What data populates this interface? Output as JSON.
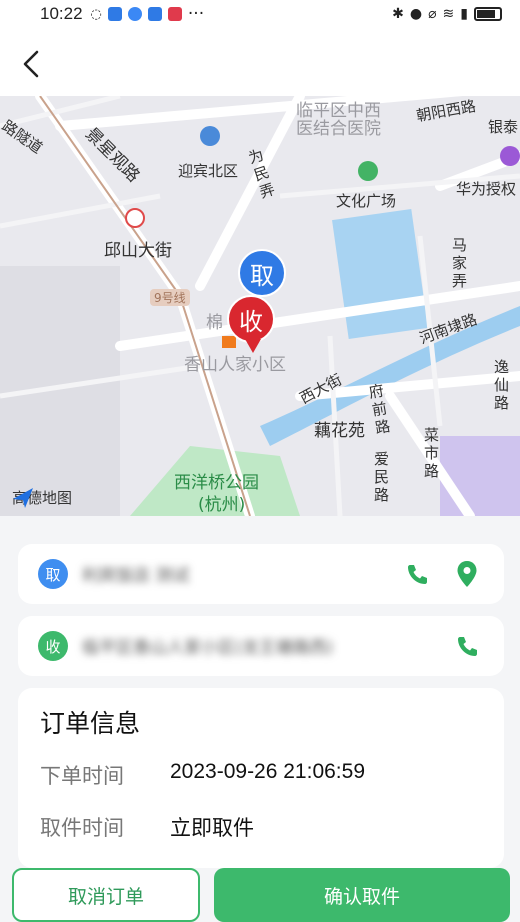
{
  "status_bar": {
    "time": "10:22",
    "more": "···",
    "notif_colors": [
      "#2f7ae5",
      "#2f7ae5",
      "#3b88f5",
      "#e03a4c"
    ]
  },
  "nav": {
    "back_icon": "chevron-left-icon"
  },
  "map": {
    "labels": [
      {
        "name": "road-jingxing",
        "text": "景星观路"
      },
      {
        "name": "road-lin",
        "text": "路隧道"
      },
      {
        "name": "hospital-linping",
        "text": "临平区中西"
      },
      {
        "name": "hospital-linping-2",
        "text": "医结合医院"
      },
      {
        "name": "road-chaoyang",
        "text": "朝阳西路"
      },
      {
        "name": "bank",
        "text": "银泰"
      },
      {
        "name": "poi-yingbin",
        "text": "迎宾北区"
      },
      {
        "name": "road-weimin",
        "text": "为民弄"
      },
      {
        "name": "poi-wenhua",
        "text": "文化广场"
      },
      {
        "name": "poi-huawei",
        "text": "华为授权"
      },
      {
        "name": "station-qiushan",
        "text": "邱山大街"
      },
      {
        "name": "road-majia",
        "text": "马家弄"
      },
      {
        "name": "line-9",
        "text": "9号线"
      },
      {
        "name": "road-henan",
        "text": "河南埭路"
      },
      {
        "name": "poi-mian",
        "text": "棉"
      },
      {
        "name": "poi-xiangshan",
        "text": "香山人家小区"
      },
      {
        "name": "road-xida",
        "text": "西大街"
      },
      {
        "name": "road-fuqian",
        "text": "府前路"
      },
      {
        "name": "road-yixian",
        "text": "逸仙路"
      },
      {
        "name": "poi-ouhua",
        "text": "藕花苑"
      },
      {
        "name": "road-caishi",
        "text": "菜市路"
      },
      {
        "name": "road-aimin",
        "text": "爱民路"
      },
      {
        "name": "park-xiyangqiao",
        "text": "西洋桥公园"
      },
      {
        "name": "park-hangzhou",
        "text": "(杭州)"
      }
    ],
    "pin_pickup": "取",
    "pin_receive": "收",
    "logo_text": "高德地图"
  },
  "pickup": {
    "badge": "取",
    "address": "利宾饭店 测试",
    "accent": "#3db96c"
  },
  "receive": {
    "badge": "收",
    "address": "临平区香山人家小区(龙王塘路西)"
  },
  "order": {
    "title": "订单信息",
    "order_time_label": "下单时间",
    "order_time_value": "2023-09-26 21:06:59",
    "pickup_time_label": "取件时间",
    "pickup_time_value": "立即取件"
  },
  "actions": {
    "cancel": "取消订单",
    "confirm": "确认取件"
  }
}
